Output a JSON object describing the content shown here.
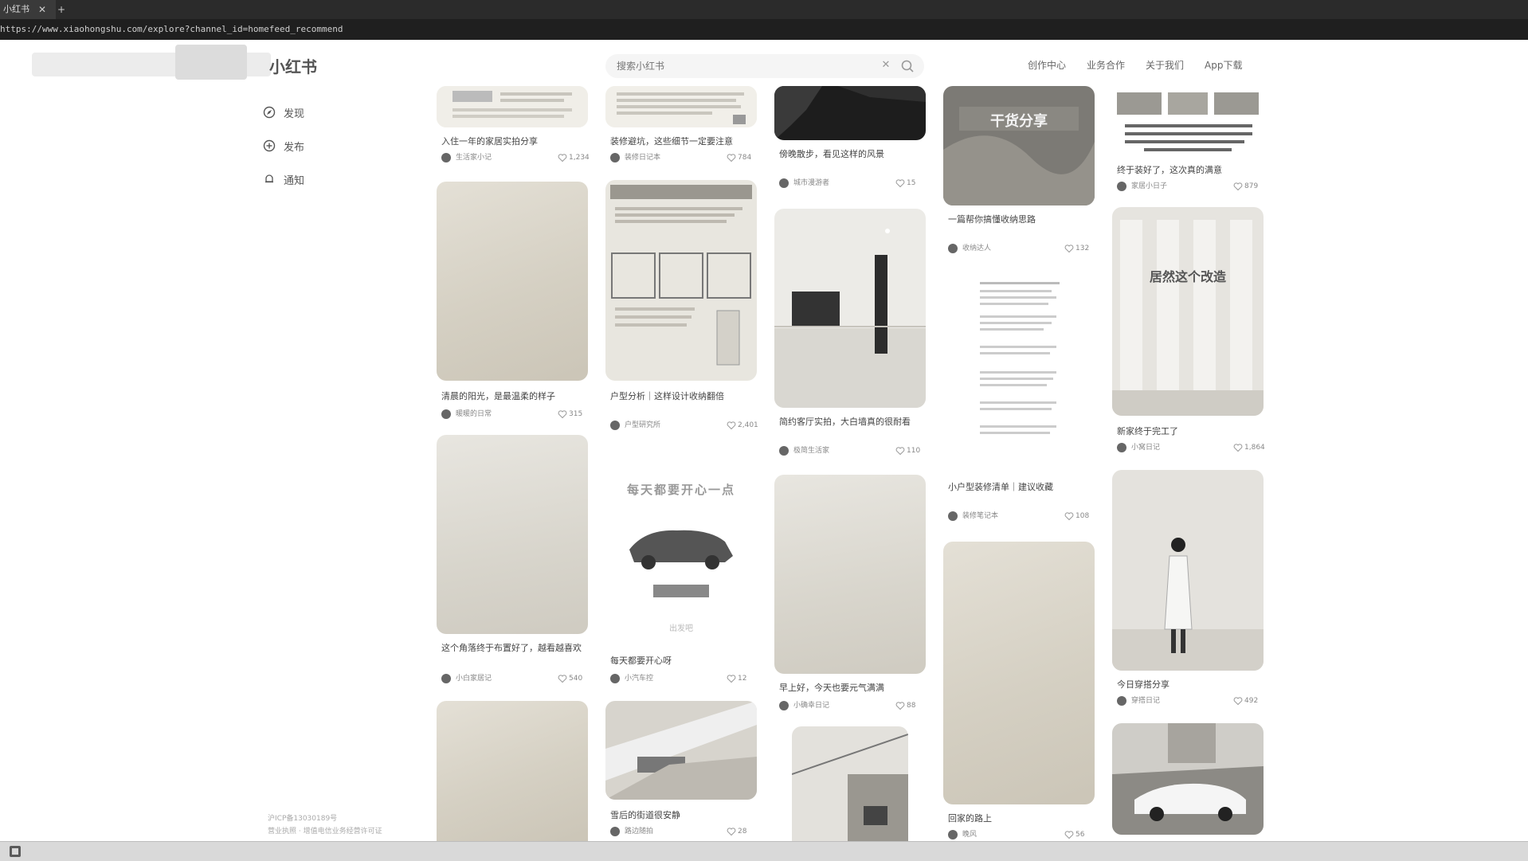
{
  "browser": {
    "tab_title": "小红书",
    "tab_close": "✕",
    "tab_new": "+",
    "url": "https://www.xiaohongshu.com/explore?channel_id=homefeed_recommend"
  },
  "header": {
    "logo": "小红书",
    "search_placeholder": "搜索小红书",
    "search_clear": "✕",
    "links": [
      "创作中心",
      "业务合作",
      "关于我们",
      "App下载"
    ]
  },
  "sidebar": {
    "items": [
      {
        "label": "发现",
        "icon": "compass-icon"
      },
      {
        "label": "发布",
        "icon": "plus-circle-icon"
      },
      {
        "label": "通知",
        "icon": "bell-icon"
      }
    ],
    "footer": [
      "沪ICP备13030189号",
      "营业执照 · 增值电信业务经营许可证"
    ]
  },
  "feed": {
    "columns": [
      [
        {
          "title": "入住一年的家居实拍分享",
          "author": "生活家小记",
          "likes": "1,234"
        },
        {
          "title": "清晨的阳光，是最温柔的样子",
          "author": "暖暖的日常",
          "likes": "315"
        },
        {
          "title": "这个角落终于布置好了，越看越喜欢",
          "author": "小白家居记",
          "likes": "540"
        },
        {
          "title": "",
          "author": "",
          "likes": ""
        }
      ],
      [
        {
          "title": "装修避坑，这些细节一定要注意",
          "author": "装修日记本",
          "likes": "784"
        },
        {
          "title": "户型分析｜这样设计收纳翻倍",
          "author": "户型研究所",
          "likes": "2,401"
        },
        {
          "title": "每天都要开心呀",
          "author": "小汽车控",
          "likes": "12"
        },
        {
          "title": "雪后的街道很安静",
          "author": "路边随拍",
          "likes": "28"
        }
      ],
      [
        {
          "title": "傍晚散步，看见这样的风景",
          "author": "城市漫游者",
          "likes": "15"
        },
        {
          "title": "简约客厅实拍，大白墙真的很耐看",
          "author": "极简生活家",
          "likes": "110"
        },
        {
          "title": "早上好，今天也要元气满满",
          "author": "小确幸日记",
          "likes": "88"
        },
        {
          "title": "",
          "author": "",
          "likes": ""
        }
      ],
      [
        {
          "title": "一篇帮你搞懂收纳思路",
          "author": "收纳达人",
          "likes": "132"
        },
        {
          "title": "小户型装修清单｜建议收藏",
          "author": "装修笔记本",
          "likes": "108"
        },
        {
          "title": "回家的路上",
          "author": "晚风",
          "likes": "56"
        }
      ],
      [
        {
          "title": "终于装好了，这次真的满意",
          "author": "家居小日子",
          "likes": "879"
        },
        {
          "title": "新家终于完工了",
          "author": "小窝日记",
          "likes": "1,864"
        },
        {
          "title": "今日穿搭分享",
          "author": "穿搭日记",
          "likes": "492"
        },
        {
          "title": "",
          "author": "",
          "likes": ""
        }
      ]
    ],
    "overlays": {
      "promo_banner": "干货分享",
      "room_caption": "居然这个改造",
      "car_headline": "每天都要开心一点",
      "car_sub": "出发吧"
    }
  },
  "colors": {
    "chrome_dark": "#2b2b2b",
    "page_bg": "#ffffff",
    "brand": "#ff2442"
  }
}
